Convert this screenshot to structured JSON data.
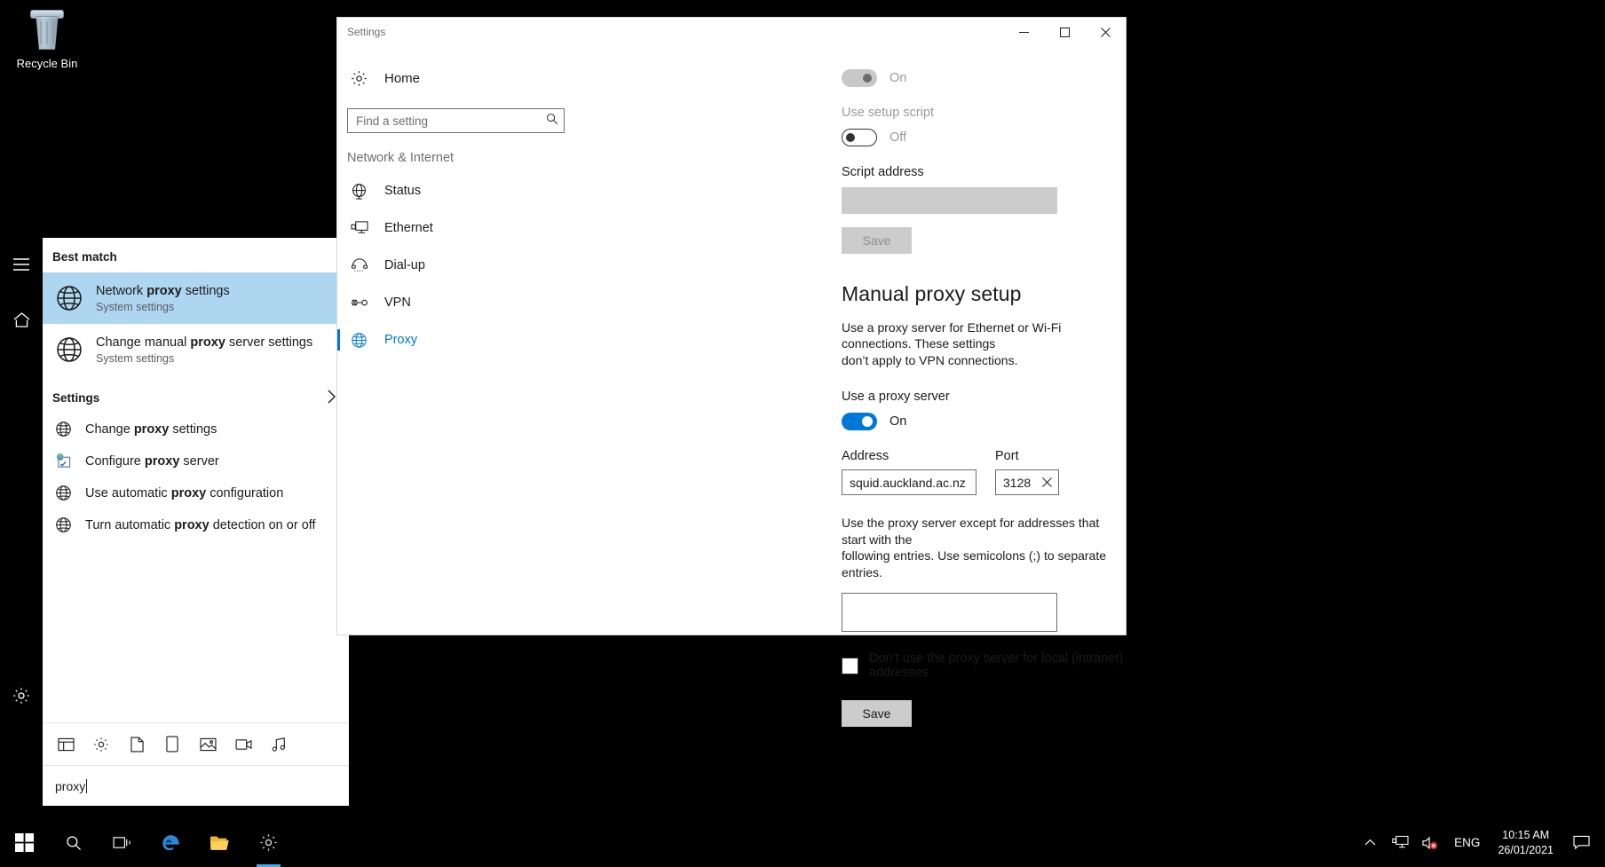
{
  "desktop": {
    "recycle_bin_label": "Recycle Bin"
  },
  "search_panel": {
    "best_match_header": "Best match",
    "best_match": {
      "title_prefix": "Network ",
      "title_bold": "proxy",
      "title_suffix": " settings",
      "subtitle": "System settings"
    },
    "second_result": {
      "title_prefix": "Change manual ",
      "title_bold": "proxy",
      "title_suffix": " server settings",
      "subtitle": "System settings"
    },
    "settings_header": "Settings",
    "settings_items": [
      {
        "prefix": "Change ",
        "bold": "proxy",
        "suffix": " settings",
        "icon": "globe-icon"
      },
      {
        "prefix": "Configure ",
        "bold": "proxy",
        "suffix": " server",
        "icon": "control-panel-icon"
      },
      {
        "prefix": "Use automatic ",
        "bold": "proxy",
        "suffix": " configuration",
        "icon": "globe-icon"
      },
      {
        "prefix": "Turn automatic ",
        "bold": "proxy",
        "suffix": " detection on or off",
        "icon": "globe-icon"
      }
    ],
    "filter_icons": [
      "apps-icon",
      "settings-gear-icon",
      "documents-icon",
      "web-icon",
      "photos-icon",
      "video-icon",
      "music-icon"
    ],
    "search_query": "proxy"
  },
  "settings_window": {
    "title": "Settings",
    "caption": {
      "minimize": "─",
      "maximize": "□",
      "close": "✕"
    },
    "sidebar": {
      "home_label": "Home",
      "search_placeholder": "Find a setting",
      "search_value": "",
      "group_label": "Network & Internet",
      "items": [
        {
          "label": "Status",
          "icon": "globe-icon",
          "active": false
        },
        {
          "label": "Ethernet",
          "icon": "ethernet-icon",
          "active": false
        },
        {
          "label": "Dial-up",
          "icon": "dialup-icon",
          "active": false
        },
        {
          "label": "VPN",
          "icon": "vpn-icon",
          "active": false
        },
        {
          "label": "Proxy",
          "icon": "globe-icon",
          "active": true
        }
      ]
    },
    "main": {
      "auto_detect_toggle_state": "On",
      "setup_script_label": "Use setup script",
      "setup_script_toggle_state": "Off",
      "script_address_label": "Script address",
      "script_address_value": "",
      "script_save_label": "Save",
      "manual_heading": "Manual proxy setup",
      "manual_description_line1": "Use a proxy server for Ethernet or Wi-Fi connections. These settings",
      "manual_description_line2": "don’t apply to VPN connections.",
      "use_proxy_label": "Use a proxy server",
      "use_proxy_toggle_state": "On",
      "address_label": "Address",
      "address_value": "squid.auckland.ac.nz",
      "port_label": "Port",
      "port_value": "3128",
      "port_clear_icon": "✕",
      "exceptions_line1": "Use the proxy server except for addresses that start with the",
      "exceptions_line2": "following entries. Use semicolons (;) to separate entries.",
      "exceptions_value": "",
      "bypass_local_label": "Don’t use the proxy server for local (intranet) addresses",
      "bypass_local_checked": false,
      "save_label": "Save"
    }
  },
  "taskbar": {
    "start_label": "start-button",
    "buttons": [
      "start-icon",
      "search-icon",
      "task-view-icon",
      "edge-icon",
      "file-explorer-icon",
      "settings-gear-icon"
    ],
    "tray": {
      "show_hidden": "∧",
      "network_icon": "network-icon",
      "volume_icon": "volume-muted-icon",
      "language": "ENG",
      "time": "10:15 AM",
      "date": "26/01/2021",
      "action_center": "action-center-icon"
    }
  },
  "colors": {
    "accent": "#0078d7",
    "selection": "#aed6f1",
    "taskbar": "#000000",
    "disabled": "#cccccc"
  }
}
